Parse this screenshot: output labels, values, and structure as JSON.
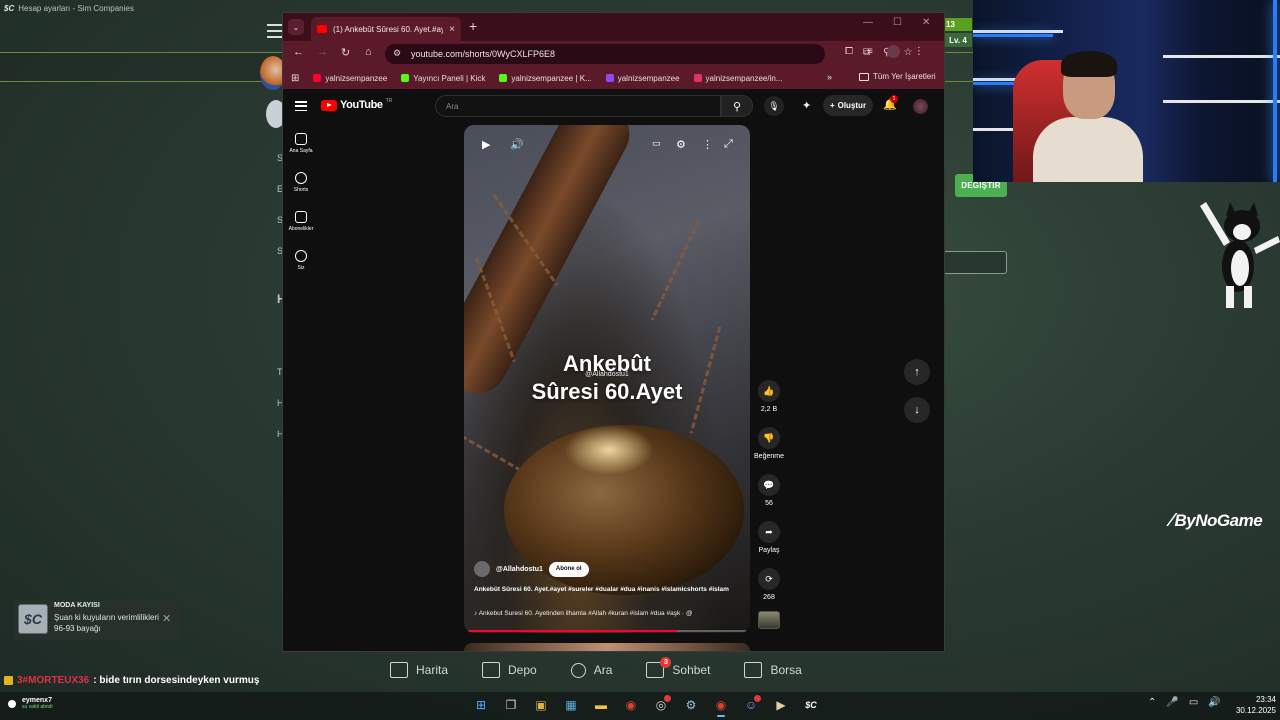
{
  "background_app": {
    "window_title": "Hesap ayarları - Sim Companies",
    "logo_mark": "$C",
    "badge_level_number": "13",
    "badge_level": "Lv. 4",
    "change_button": "DEĞİŞTİR",
    "side_letters": [
      "S",
      "E",
      "S",
      "S",
      "H",
      "T",
      "H",
      "H"
    ]
  },
  "browser": {
    "tab_title": "(1) Ankebût Sûresi 60. Ayet.#ay",
    "url": "youtube.com/shorts/0WyCXLFP6E8",
    "bookmarks": [
      {
        "label": "yalnizsempanzee",
        "color": "#ff0033"
      },
      {
        "label": "Yayıncı Paneli | Kick",
        "color": "#53fc18"
      },
      {
        "label": "yalnizsempanzee | K...",
        "color": "#53fc18"
      },
      {
        "label": "yalnizsempanzee",
        "color": "#9146ff"
      },
      {
        "label": "yalnizsempanzee/in...",
        "color": "#e1306c"
      }
    ],
    "bookmarks_more": "»",
    "all_bookmarks": "Tüm Yer İşaretleri"
  },
  "youtube": {
    "logo_text": "YouTube",
    "logo_suffix": "TR",
    "search_placeholder": "Ara",
    "create_label": "Oluştur",
    "notification_count": "1",
    "sidebar": [
      {
        "label": "Ana Sayfa",
        "icon": "home-icon"
      },
      {
        "label": "Shorts",
        "icon": "shorts-icon"
      },
      {
        "label": "Abonelikler",
        "icon": "subscriptions-icon"
      },
      {
        "label": "Siz",
        "icon": "you-icon"
      }
    ],
    "short": {
      "overlay_title_line1": "Ankebût",
      "overlay_title_line2": "Sûresi 60.Ayet",
      "overlay_handle": "@Allahdostu1",
      "channel": "@Allahdostu1",
      "subscribe_label": "Abone ol",
      "caption": "Ankebût Sûresi 60. Ayet.#ayet #sureler #dualar #dua #inanis #islamicshorts #islam",
      "music_line": "♪ Ankebut Suresi 60. Ayetinden ilhamla #Allah #kuran #islam #dua #aşk · @",
      "progress": 0.75
    },
    "actions": {
      "like_count": "2,2 B",
      "dislike_label": "Beğenme",
      "comment_count": "56",
      "share_label": "Paylaş",
      "remix_count": "268"
    }
  },
  "overlay": {
    "brand": "ByNoGame"
  },
  "notification": {
    "title": "MODA KAYISI",
    "body": "Şuan ki kuyuların verimlilikleri 96-93 bayağı",
    "icon": "$C"
  },
  "chat": {
    "user": "3#MORTEUX36",
    "message": ": bide tırın dorsesindeyken vurmuş"
  },
  "app_nav": [
    {
      "label": "Harita",
      "icon": "map-icon"
    },
    {
      "label": "Depo",
      "icon": "warehouse-icon"
    },
    {
      "label": "Ara",
      "icon": "search-icon"
    },
    {
      "label": "Sohbet",
      "icon": "chat-icon",
      "badge": "3"
    },
    {
      "label": "Borsa",
      "icon": "exchange-icon"
    }
  ],
  "taskbar": {
    "user_name": "eymenx7",
    "user_status": "su vakti abndi",
    "time": "23:34",
    "date": "30.12.2025"
  }
}
